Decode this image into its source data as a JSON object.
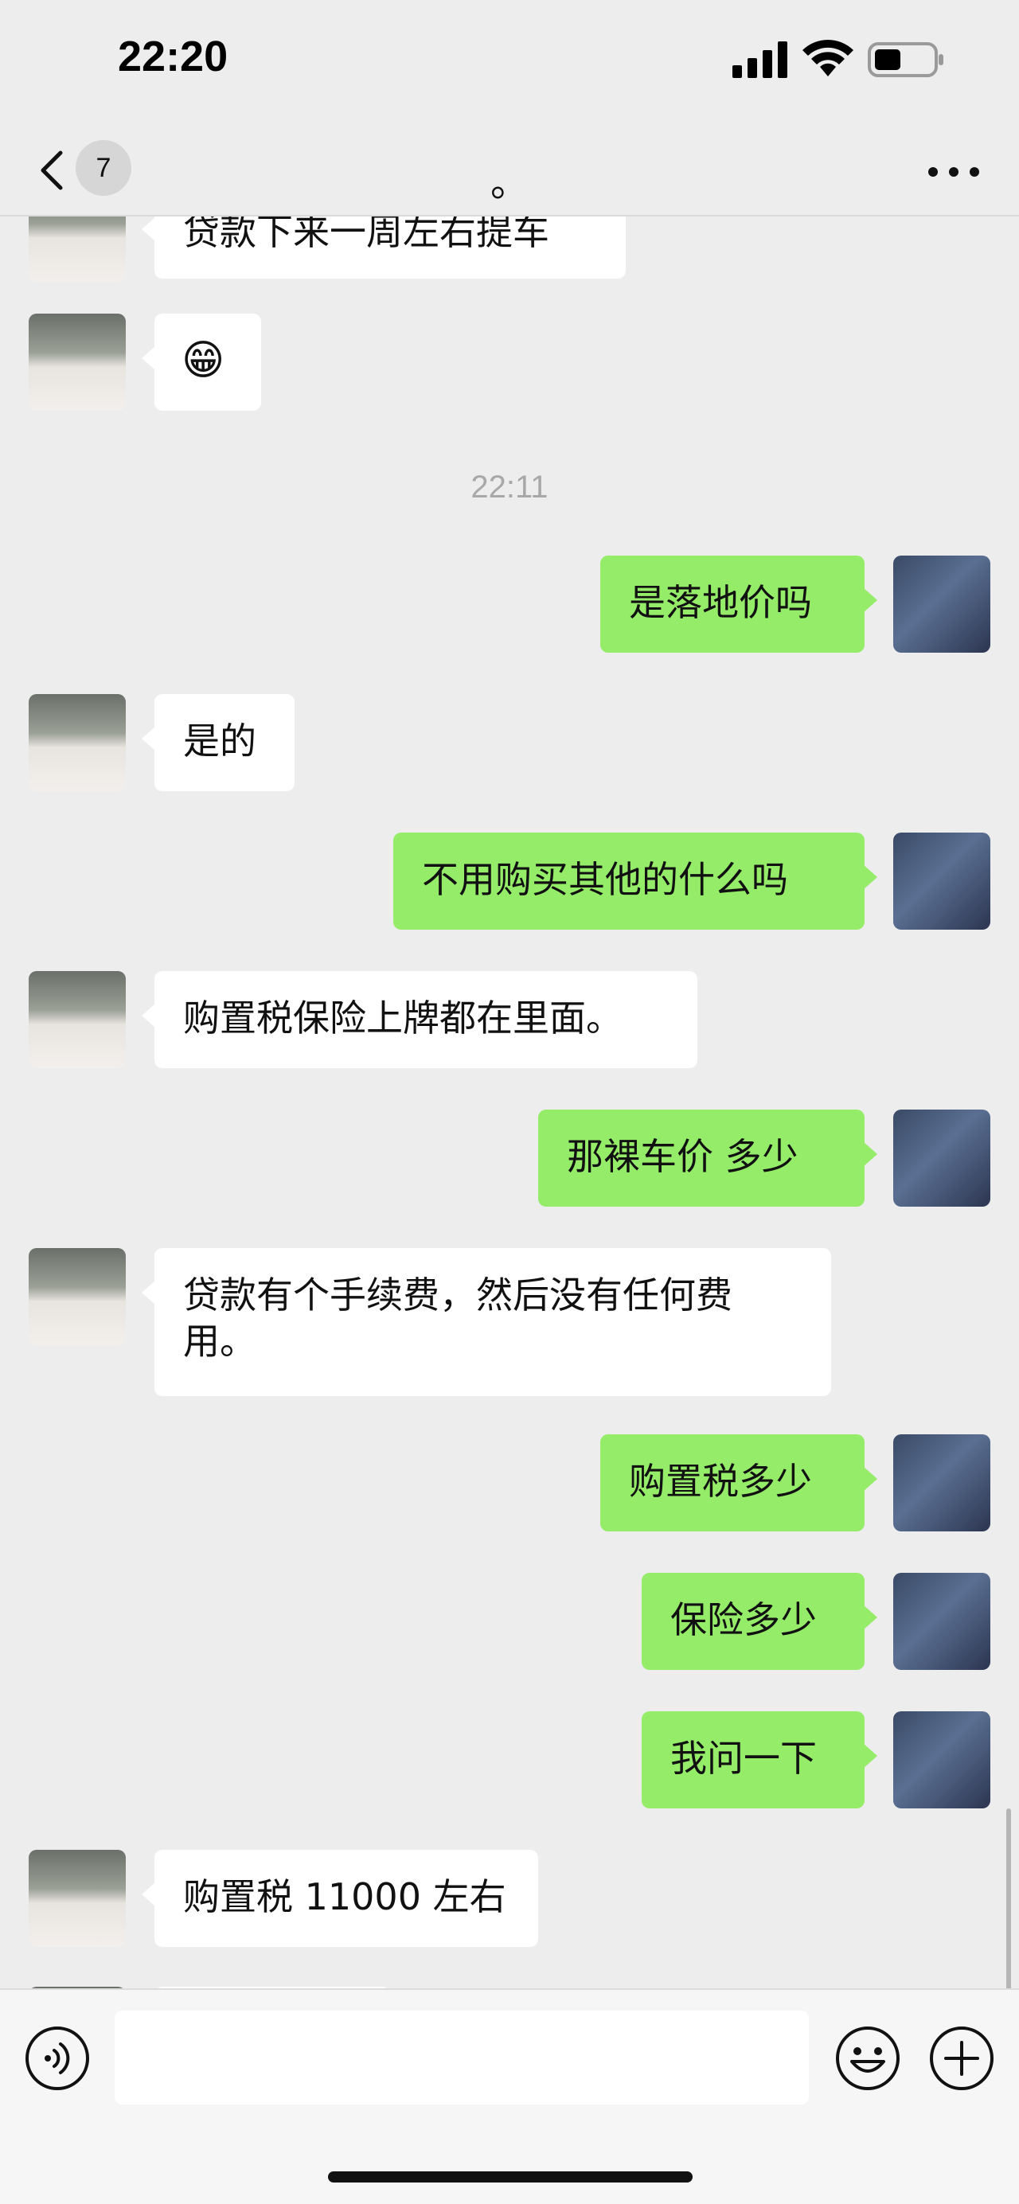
{
  "status_bar": {
    "time": "22:20"
  },
  "nav": {
    "unread_count": "7",
    "title": "。"
  },
  "messages": [
    {
      "side": "in",
      "text": "贷款下来一周左右提车"
    },
    {
      "side": "in",
      "text": "😁"
    },
    {
      "timestamp": "22:11"
    },
    {
      "side": "out",
      "text": "是落地价吗"
    },
    {
      "side": "in",
      "text": "是的"
    },
    {
      "side": "out",
      "text": "不用购买其他的什么吗"
    },
    {
      "side": "in",
      "text": "购置税保险上牌都在里面。"
    },
    {
      "side": "out",
      "text": "那裸车价 多少"
    },
    {
      "side": "in",
      "text_line1": "贷款有个手续费，然后没有任何费",
      "text_line2": "用。"
    },
    {
      "side": "out",
      "text": "购置税多少"
    },
    {
      "side": "out",
      "text": "保险多少"
    },
    {
      "side": "out",
      "text": "我问一下"
    },
    {
      "side": "in",
      "text": "购置税 11000 左右"
    }
  ],
  "input": {
    "value": ""
  },
  "icons": {
    "back": "chevron-left-icon",
    "more": "more-horizontal-icon",
    "voice": "voice-icon",
    "emoji": "emoji-icon",
    "plus": "plus-icon"
  },
  "colors": {
    "background": "#ededed",
    "incoming_bubble": "#ffffff",
    "outgoing_bubble": "#95ec69",
    "timestamp": "#a8a8a8"
  }
}
